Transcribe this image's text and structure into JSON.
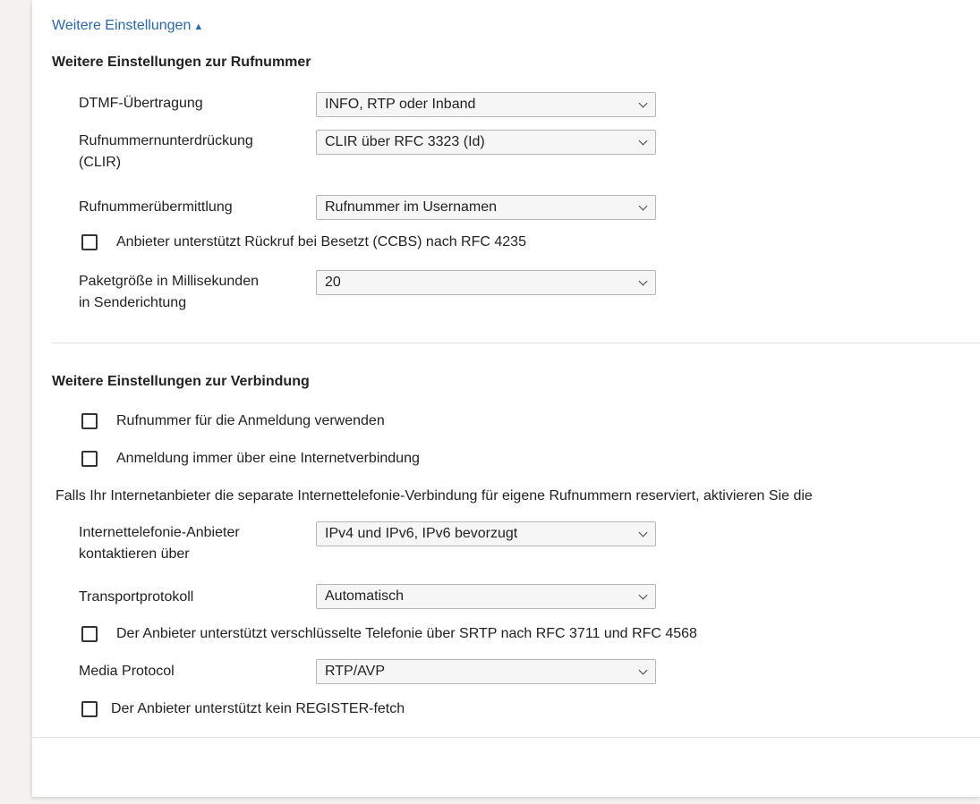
{
  "toggle": {
    "label": "Weitere Einstellungen",
    "arrow": "▲"
  },
  "rufnummer": {
    "title": "Weitere Einstellungen zur Rufnummer",
    "dtmf": {
      "label": "DTMF-Übertragung",
      "value": "INFO, RTP oder Inband"
    },
    "clir": {
      "label_line1": "Rufnummernunterdrückung",
      "label_line2": "(CLIR)",
      "value": "CLIR über RFC 3323 (Id)"
    },
    "uebermittlung": {
      "label": "Rufnummerübermittlung",
      "value": "Rufnummer im Usernamen"
    },
    "ccbs": {
      "label": "Anbieter unterstützt Rückruf bei Besetzt (CCBS) nach RFC 4235"
    },
    "paketgroesse": {
      "label_line1": "Paketgröße in Millisekunden",
      "label_line2": "in Senderichtung",
      "value": "20"
    }
  },
  "verbindung": {
    "title": "Weitere Einstellungen zur Verbindung",
    "rufnummer_anmeldung": {
      "label": "Rufnummer für die Anmeldung verwenden"
    },
    "anmeldung_internet": {
      "label": "Anmeldung immer über eine Internetverbindung"
    },
    "info_text": "Falls Ihr Internetanbieter die separate Internettelefonie-Verbindung für eigene Rufnummern reserviert, aktivieren Sie die",
    "kontaktieren": {
      "label_line1": "Internettelefonie-Anbieter",
      "label_line2": "kontaktieren über",
      "value": "IPv4 und IPv6, IPv6 bevorzugt"
    },
    "transport": {
      "label": "Transportprotokoll",
      "value": "Automatisch"
    },
    "srtp": {
      "label": "Der Anbieter unterstützt verschlüsselte Telefonie über SRTP nach RFC 3711 und RFC 4568"
    },
    "media": {
      "label": "Media Protocol",
      "value": "RTP/AVP"
    },
    "register_fetch": {
      "label": "Der Anbieter unterstützt kein REGISTER-fetch"
    }
  },
  "colors": {
    "link": "#2b6aa6",
    "background": "#f4f2ee",
    "panel": "#ffffff"
  },
  "icons": {
    "select_arrow": "chevron-down-icon",
    "toggle_arrow": "triangle-up-icon"
  }
}
